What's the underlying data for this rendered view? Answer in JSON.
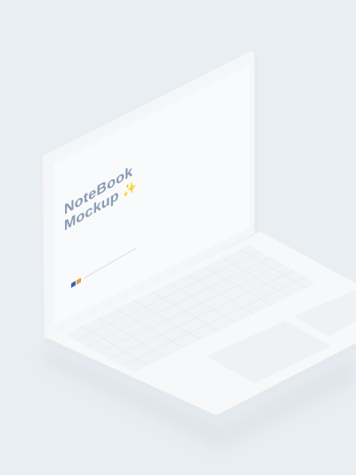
{
  "screen": {
    "title_line1": "NoteBook",
    "title_line2": "Mockup",
    "sparkle": "✨",
    "subtitle": ""
  },
  "colors": {
    "background": "#e9eef2",
    "body": "#f7f8fa",
    "screen": "#f9fafb",
    "keys": "#f1f4f7",
    "title": "#8a9bb3",
    "accent_blue": "#3a62b8",
    "accent_orange": "#e59a4c"
  }
}
